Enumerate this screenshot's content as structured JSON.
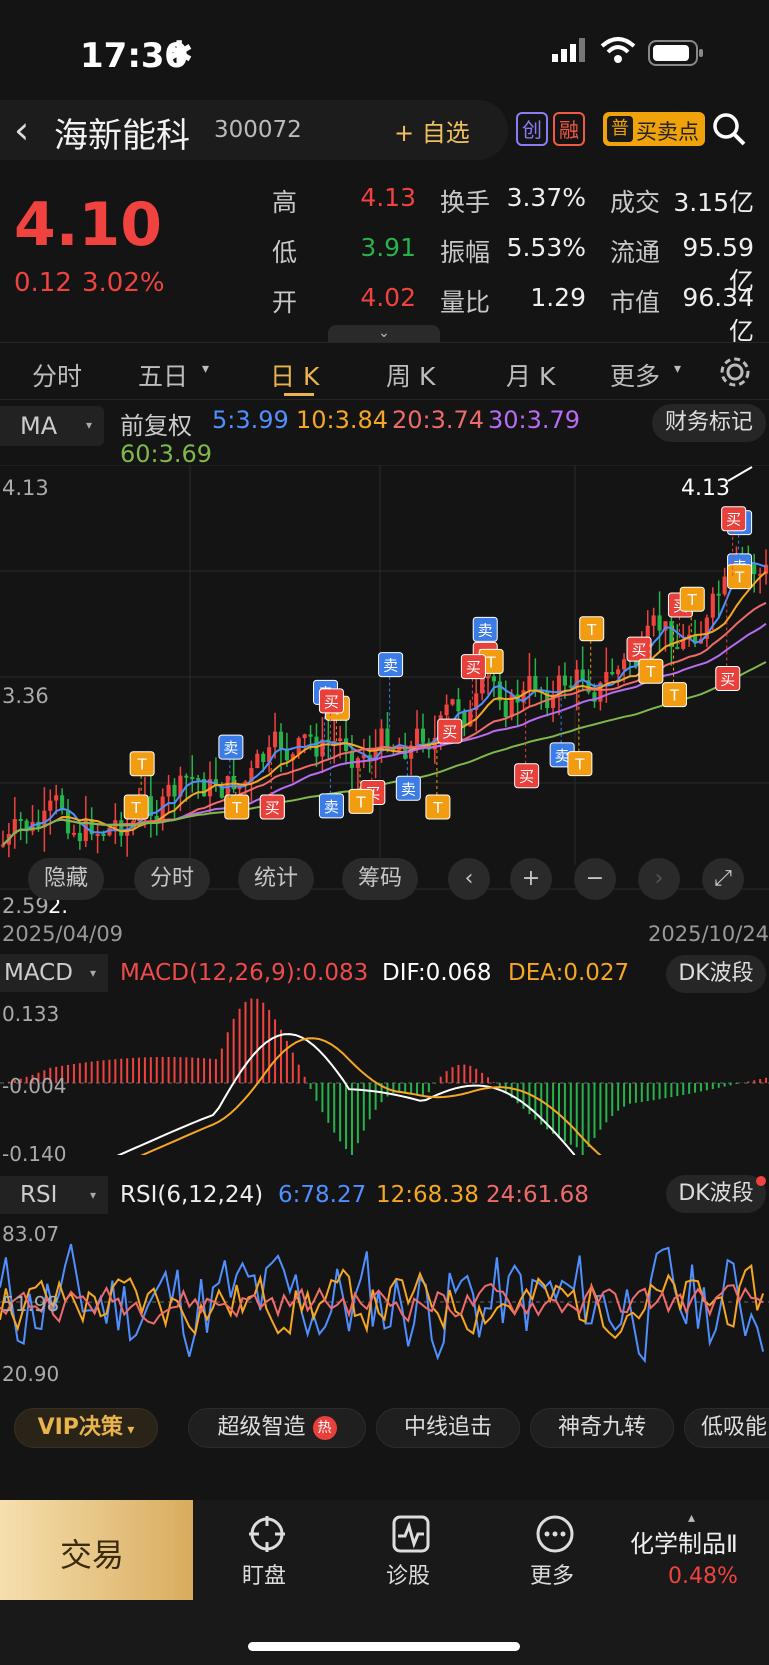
{
  "status": {
    "time": "17:30"
  },
  "header": {
    "back": "‹",
    "title": "海新能科",
    "code": "300072",
    "add": "+ 自选",
    "badges": [
      "创",
      "融"
    ],
    "signal": "买卖点",
    "signal_icon": "普"
  },
  "quote": {
    "price": "4.10",
    "change": "0.12",
    "pct": "3.02%",
    "rows": [
      {
        "l1": "高",
        "v1": "4.13",
        "l2": "换手",
        "v2": "3.37%",
        "l3": "成交",
        "v3": "3.15亿"
      },
      {
        "l1": "低",
        "v1": "3.91",
        "l2": "振幅",
        "v2": "5.53%",
        "l3": "流通",
        "v3": "95.59亿"
      },
      {
        "l1": "开",
        "v1": "4.02",
        "l2": "量比",
        "v2": "1.29",
        "l3": "市值",
        "v3": "96.34亿"
      }
    ]
  },
  "tabs": [
    "分时",
    "五日",
    "日 K",
    "周 K",
    "月 K",
    "更多"
  ],
  "tab_arrows": [
    "▾",
    "▾"
  ],
  "ma": {
    "type": "MA",
    "adj": "前复权",
    "m5": "5:3.99",
    "m10": "10:3.84",
    "m20": "20:3.74",
    "m30": "30:3.79",
    "m60": "60:3.69",
    "fin": "财务标记"
  },
  "kaxis": {
    "top": "4.13",
    "mid": "3.36",
    "bot": "2.59",
    "high_label": "4.13",
    "low_label": "2.",
    "start": "2025/04/09",
    "end": "2025/10/24"
  },
  "tools": [
    "隐藏",
    "分时",
    "统计",
    "筹码"
  ],
  "markers": {
    "buy": "买",
    "sell": "卖",
    "t": "T"
  },
  "macd": {
    "name": "MACD",
    "param": "MACD(12,26,9):0.083",
    "dif": "DIF:0.068",
    "dea": "DEA:0.027",
    "btn": "DK波段",
    "y1": "0.133",
    "y2": "-0.004",
    "y3": "-0.140"
  },
  "rsi": {
    "name": "RSI",
    "param": "RSI(6,12,24)",
    "r6": "6:78.27",
    "r12": "12:68.38",
    "r24": "24:61.68",
    "btn": "DK波段",
    "y1": "83.07",
    "y2": "51.98",
    "y3": "20.90"
  },
  "strip": {
    "vip": "VIP决策",
    "items": [
      "超级智造",
      "中线追击",
      "神奇九转",
      "低吸能"
    ],
    "hot": "热"
  },
  "bottom": {
    "trade": "交易",
    "items": [
      "盯盘",
      "诊股",
      "更多"
    ],
    "sector": "化学制品Ⅱ",
    "sector_pct": "0.48%"
  },
  "colors": {
    "up": "#f0433f",
    "down": "#26b34a",
    "gold": "#e9b44c",
    "ma5": "#4f8fff",
    "ma10": "#f5a623",
    "ma20": "#ef6b6b",
    "ma30": "#b86cf2",
    "ma60": "#7fb84b"
  }
}
